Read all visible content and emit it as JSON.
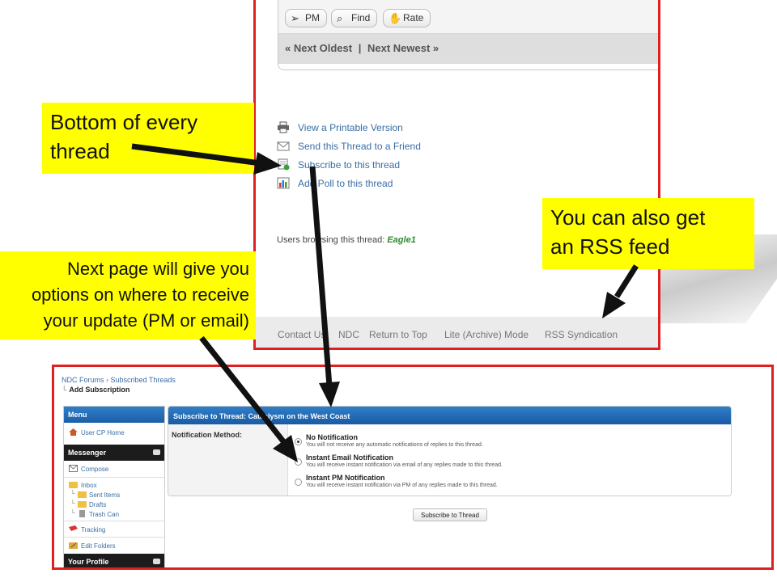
{
  "thread_page": {
    "post_buttons": [
      {
        "label": "PM",
        "icon": "paper-plane-icon"
      },
      {
        "label": "Find",
        "icon": "magnifier-icon"
      },
      {
        "label": "Rate",
        "icon": "thumbs-up-icon"
      }
    ],
    "nav": {
      "prev": "« Next Oldest",
      "sep": "|",
      "next": "Next Newest »"
    },
    "tools": [
      {
        "label": "View a Printable Version",
        "icon": "printer-icon"
      },
      {
        "label": "Send this Thread to a Friend",
        "icon": "envelope-icon"
      },
      {
        "label": "Subscribe to this thread",
        "icon": "subscribe-icon"
      },
      {
        "label": "Add Poll to this thread",
        "icon": "poll-icon"
      }
    ],
    "browsing_label": "Users browsing this thread:",
    "browsing_user": "Eagle1",
    "footer_links": [
      "Contact Us",
      "NDC",
      "Return to Top",
      "Lite (Archive) Mode",
      "RSS Syndication"
    ]
  },
  "callouts": {
    "bottom": [
      "Bottom of every",
      "thread"
    ],
    "rss": [
      "You can also get",
      "an RSS feed"
    ],
    "next": [
      "Next page will give you",
      "options on where to receive",
      "your update (PM or email)"
    ]
  },
  "subscription_page": {
    "breadcrumb": [
      "NDC Forums",
      "Subscribed Threads"
    ],
    "breadcrumb_sep": "›",
    "page_title": "Add Subscription",
    "menu": {
      "title": "Menu",
      "cp_home": "User CP Home",
      "messenger_title": "Messenger",
      "compose": "Compose",
      "inbox": "Inbox",
      "sent": "Sent Items",
      "drafts": "Drafts",
      "trash": "Trash Can",
      "tracking": "Tracking",
      "edit_folders": "Edit Folders",
      "profile_title": "Your Profile"
    },
    "panel_title": "Subscribe to Thread: Cataclysm on the West Coast",
    "method_label": "Notification Method:",
    "options": [
      {
        "title": "No Notification",
        "desc": "You will not receive any automatic notifications of replies to this thread.",
        "selected": true
      },
      {
        "title": "Instant Email Notification",
        "desc": "You will receive instant notification via email of any replies made to this thread.",
        "selected": false
      },
      {
        "title": "Instant PM Notification",
        "desc": "You will receive instant notification via PM of any replies made to this thread.",
        "selected": false
      }
    ],
    "submit_label": "Subscribe to Thread"
  },
  "colors": {
    "frame_red": "#e02020",
    "callout_yellow": "#ffff00",
    "link_blue": "#3a6ea5",
    "header_blue": "#2f7fc8"
  }
}
